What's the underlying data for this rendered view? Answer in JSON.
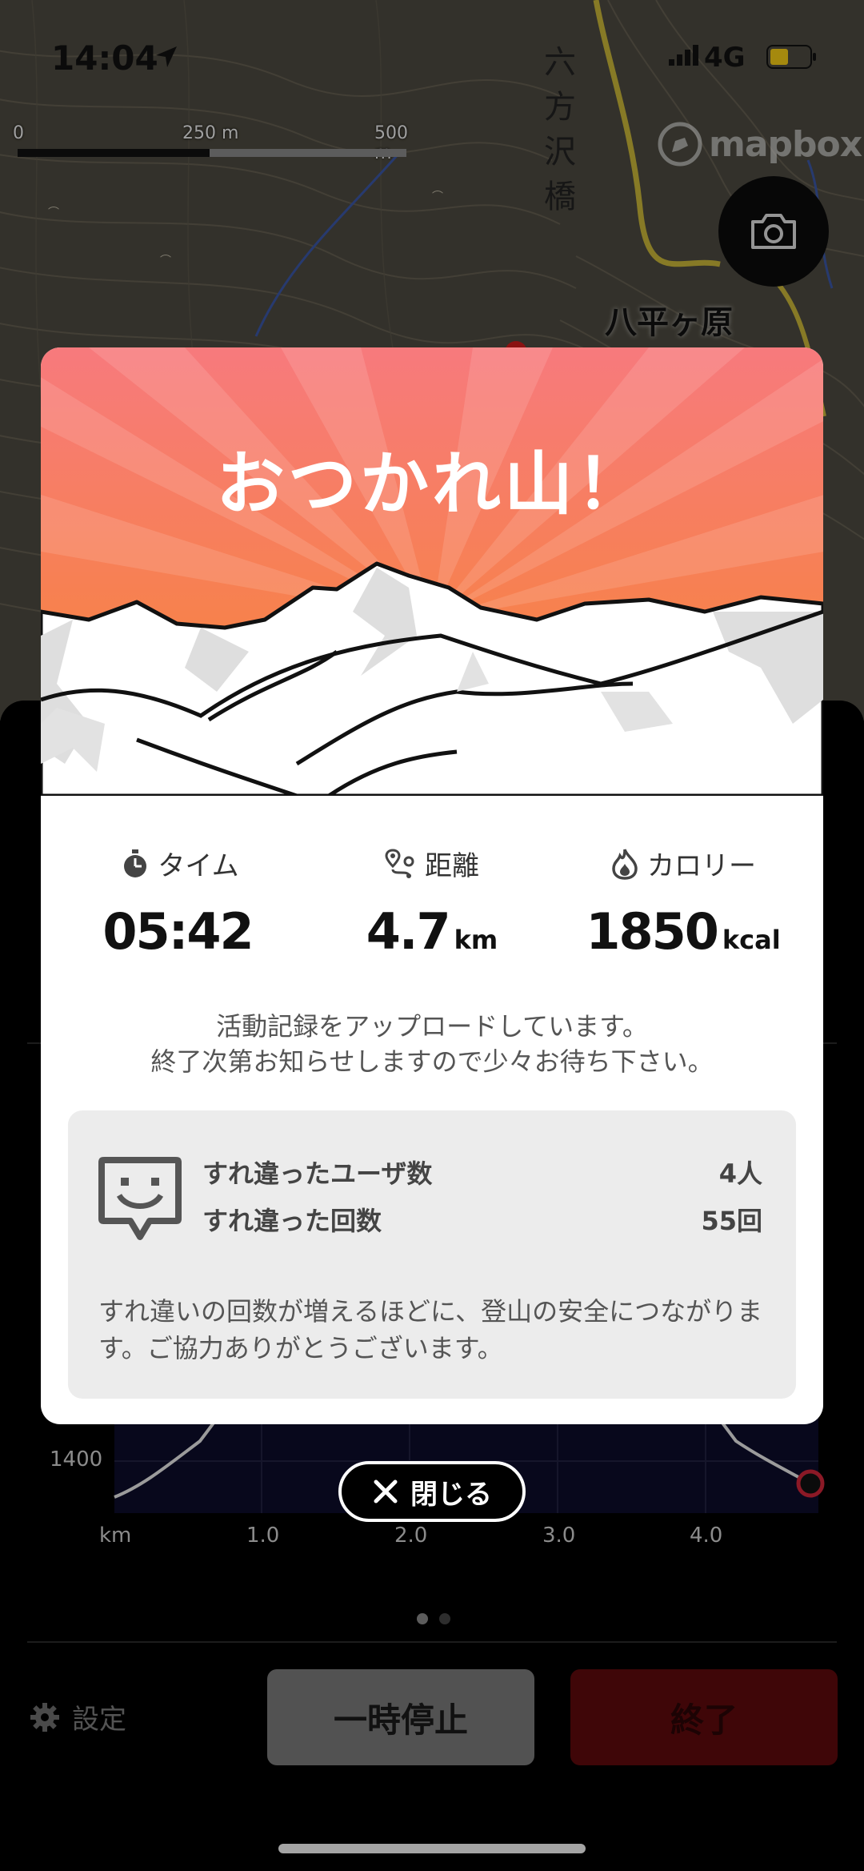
{
  "status_bar": {
    "time": "14:04",
    "network": "4G"
  },
  "map": {
    "scale_labels": [
      "0",
      "250 m",
      "500 m"
    ],
    "attribution": "mapbox",
    "place_name": "八平ヶ原",
    "vertical_label": "六方沢橋"
  },
  "modal": {
    "title": "おつかれ山！",
    "stats": [
      {
        "label": "タイム",
        "value": "05:42",
        "unit": "",
        "icon": "stopwatch-icon"
      },
      {
        "label": "距離",
        "value": "4.7",
        "unit": "km",
        "icon": "route-icon"
      },
      {
        "label": "カロリー",
        "value": "1850",
        "unit": "kcal",
        "icon": "flame-icon"
      }
    ],
    "upload_message_line1": "活動記録をアップロードしています。",
    "upload_message_line2": "終了次第お知らせしますので少々お待ち下さい。",
    "passing": {
      "users_label": "すれ違ったユーザ数",
      "users_value": "4人",
      "count_label": "すれ違った回数",
      "count_value": "55回",
      "note": "すれ違いの回数が増えるほどに、登山の安全につながります。ご協力ありがとうございます。"
    }
  },
  "close_button": {
    "label": "閉じる"
  },
  "chart_data": {
    "type": "area",
    "x_ticks": [
      "km",
      "1.0",
      "2.0",
      "3.0",
      "4.0"
    ],
    "y_ticks": [
      "1400"
    ]
  },
  "bottom": {
    "settings_label": "設定",
    "pause_label": "一時停止",
    "end_label": "終了"
  },
  "colors": {
    "banner_top": "#f77a7d",
    "banner_bottom": "#f7862e",
    "end_button": "#5e0a0c",
    "pause_button": "#7b7b7b"
  }
}
